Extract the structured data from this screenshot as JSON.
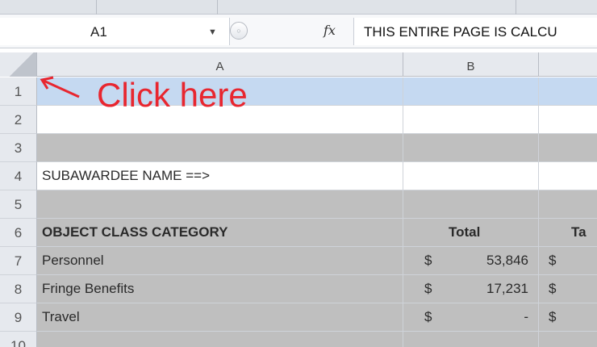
{
  "formula_bar": {
    "name_box": "A1",
    "fx_label": "fx",
    "formula": "THIS ENTIRE PAGE IS CALCU"
  },
  "columns": [
    "A",
    "B"
  ],
  "rows": [
    {
      "num": "1",
      "a": ""
    },
    {
      "num": "2",
      "a": ""
    },
    {
      "num": "3",
      "a": ""
    },
    {
      "num": "4",
      "a": "SUBAWARDEE NAME ==>"
    },
    {
      "num": "5",
      "a": ""
    },
    {
      "num": "6",
      "a": "OBJECT CLASS CATEGORY",
      "b": "Total",
      "c": "Ta"
    },
    {
      "num": "7",
      "a": "Personnel",
      "b_sym": "$",
      "b": "53,846",
      "c_sym": "$"
    },
    {
      "num": "8",
      "a": "Fringe Benefits",
      "b_sym": "$",
      "b": "17,231",
      "c_sym": "$"
    },
    {
      "num": "9",
      "a": "Travel",
      "b_sym": "$",
      "b": "-",
      "c_sym": "$"
    },
    {
      "num": "10",
      "a": ""
    }
  ],
  "annotation": {
    "text": "Click here",
    "color": "#e8262f"
  }
}
